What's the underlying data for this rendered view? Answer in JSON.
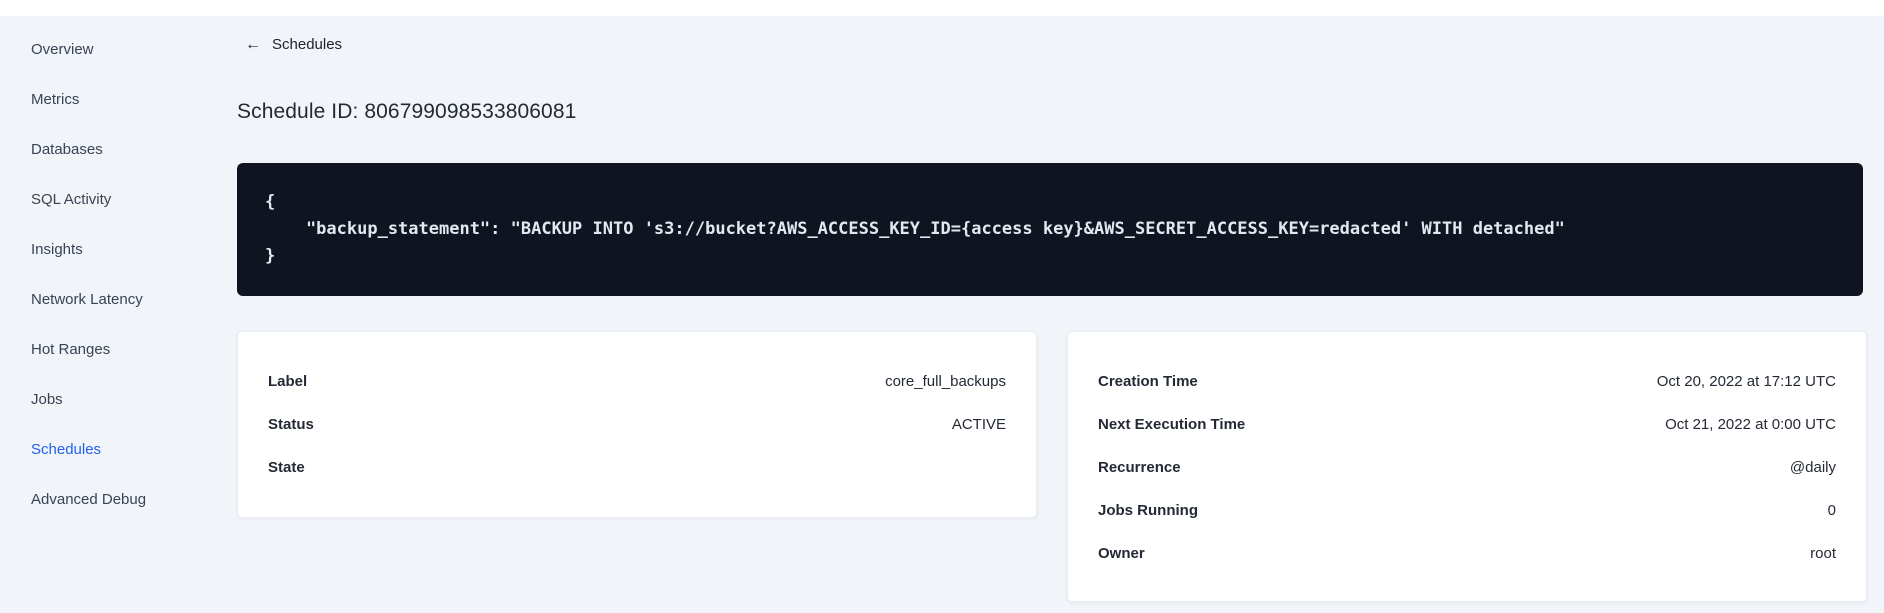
{
  "sidebar": {
    "items": [
      {
        "label": "Overview",
        "active": false
      },
      {
        "label": "Metrics",
        "active": false
      },
      {
        "label": "Databases",
        "active": false
      },
      {
        "label": "SQL Activity",
        "active": false
      },
      {
        "label": "Insights",
        "active": false
      },
      {
        "label": "Network Latency",
        "active": false
      },
      {
        "label": "Hot Ranges",
        "active": false
      },
      {
        "label": "Jobs",
        "active": false
      },
      {
        "label": "Schedules",
        "active": true
      },
      {
        "label": "Advanced Debug",
        "active": false
      }
    ]
  },
  "header": {
    "back_icon": "arrow-left",
    "back_label": "Schedules",
    "back_arrow_glyph": "←",
    "title": "Schedule ID: 806799098533806081"
  },
  "code_block": {
    "lines": [
      "{",
      "    \"backup_statement\": \"BACKUP INTO 's3://bucket?AWS_ACCESS_KEY_ID={access key}&AWS_SECRET_ACCESS_KEY=redacted' WITH detached\"",
      "}"
    ]
  },
  "details_card": {
    "rows": [
      {
        "label": "Label",
        "value": "core_full_backups"
      },
      {
        "label": "Status",
        "value": "ACTIVE"
      },
      {
        "label": "State",
        "value": ""
      }
    ]
  },
  "schedule_card": {
    "rows": [
      {
        "label": "Creation Time",
        "value": "Oct 20, 2022 at 17:12 UTC"
      },
      {
        "label": "Next Execution Time",
        "value": "Oct 21, 2022 at 0:00 UTC"
      },
      {
        "label": "Recurrence",
        "value": "@daily"
      },
      {
        "label": "Jobs Running",
        "value": "0"
      },
      {
        "label": "Owner",
        "value": "root"
      }
    ]
  },
  "colors": {
    "accent_blue": "#2260F2",
    "page_background": "#F1F4F8",
    "code_background": "#0F1420",
    "code_text": "#E3E8EF",
    "card_background": "#FFFFFF",
    "text_dark": "#242A35",
    "sidebar_text": "#3A4254"
  }
}
